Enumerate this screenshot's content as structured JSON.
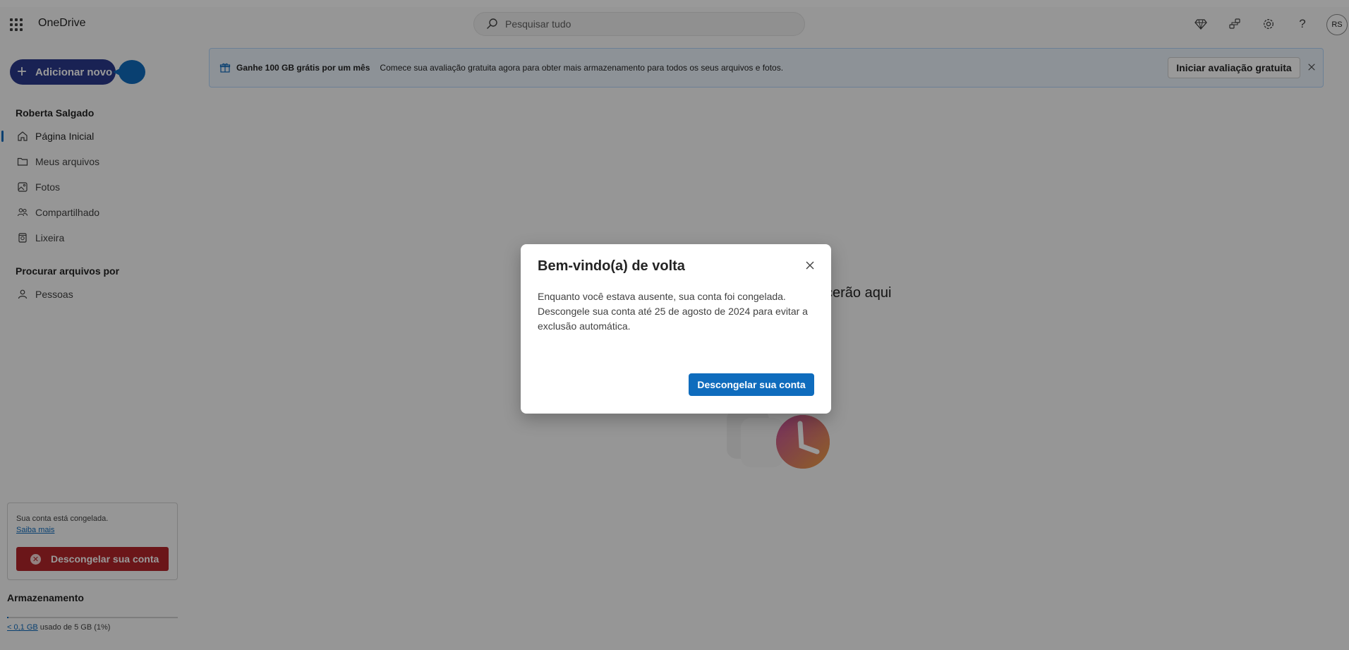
{
  "app": {
    "brand": "OneDrive",
    "user_initials": "RS"
  },
  "search": {
    "placeholder": "Pesquisar tudo"
  },
  "header_icons": [
    "premium-diamond-icon",
    "share-network-icon",
    "settings-gear-icon",
    "help-question-icon"
  ],
  "sidebar": {
    "add_new_label": "Adicionar novo",
    "account_name": "Roberta Salgado",
    "items": [
      {
        "label": "Página Inicial",
        "icon": "home-icon",
        "active": true
      },
      {
        "label": "Meus arquivos",
        "icon": "folder-icon",
        "active": false
      },
      {
        "label": "Fotos",
        "icon": "photo-icon",
        "active": false
      },
      {
        "label": "Compartilhado",
        "icon": "people-icon",
        "active": false
      },
      {
        "label": "Lixeira",
        "icon": "trash-icon",
        "active": false
      }
    ],
    "browse_title": "Procurar arquivos por",
    "browse_items": [
      {
        "label": "Pessoas",
        "icon": "person-icon"
      }
    ],
    "frozen": {
      "message": "Sua conta está congelada.",
      "learn_more": "Saiba mais",
      "button_label": "Descongelar sua conta"
    },
    "storage": {
      "title": "Armazenamento",
      "used": "< 0,1 GB",
      "rest": " usado de 5 GB (1%)",
      "percent": 1
    }
  },
  "banner": {
    "title": "Ganhe 100 GB grátis por um mês",
    "text": "Comece sua avaliação gratuita agora para obter mais armazenamento para todos os seus arquivos e fotos.",
    "button_label": "Iniciar avaliação gratuita"
  },
  "main": {
    "empty_text_partial": "cerão aqui"
  },
  "dialog": {
    "title": "Bem-vindo(a) de volta",
    "body": "Enquanto você estava ausente, sua conta foi congelada. Descongele sua conta até 25 de agosto de 2024 para evitar a exclusão automática.",
    "button_label": "Descongelar sua conta"
  },
  "colors": {
    "accent": "#0f6cbd",
    "add_button": "#2b3a8c",
    "danger": "#b3262a",
    "banner_bg": "#ebf3fc"
  }
}
